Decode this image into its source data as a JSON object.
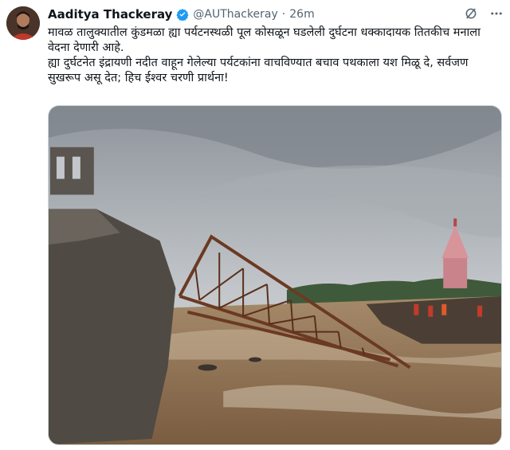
{
  "author": {
    "name": "Aaditya Thackeray",
    "handle": "@AUThackeray",
    "separator": "·",
    "time": "26m",
    "verified": true
  },
  "tweet": {
    "line1": "मावळ तालुक्यातील कुंडमळा ह्या पर्यटनस्थळी पूल कोसळून घडलेली दुर्घटना धक्कादायक तितकीच मनाला वेदना देणारी आहे.",
    "line2": "ह्या दुर्घटनेत इंद्रायणी नदीत वाहून गेलेल्या पर्यटकांना वाचविण्यात बचाव पथकाला यश मिळू दे, सर्वजण सुखरूप असू देत; हिच ईश्वर चरणी प्रार्थना!"
  },
  "icons": {
    "verified": "verified-badge-icon",
    "grok": "grok-icon",
    "more": "more-options-icon"
  },
  "colors": {
    "verified": "#1d9bf0",
    "secondary_text": "#536471",
    "water": "#8a6a4a",
    "sky": "#9aa0a6"
  }
}
